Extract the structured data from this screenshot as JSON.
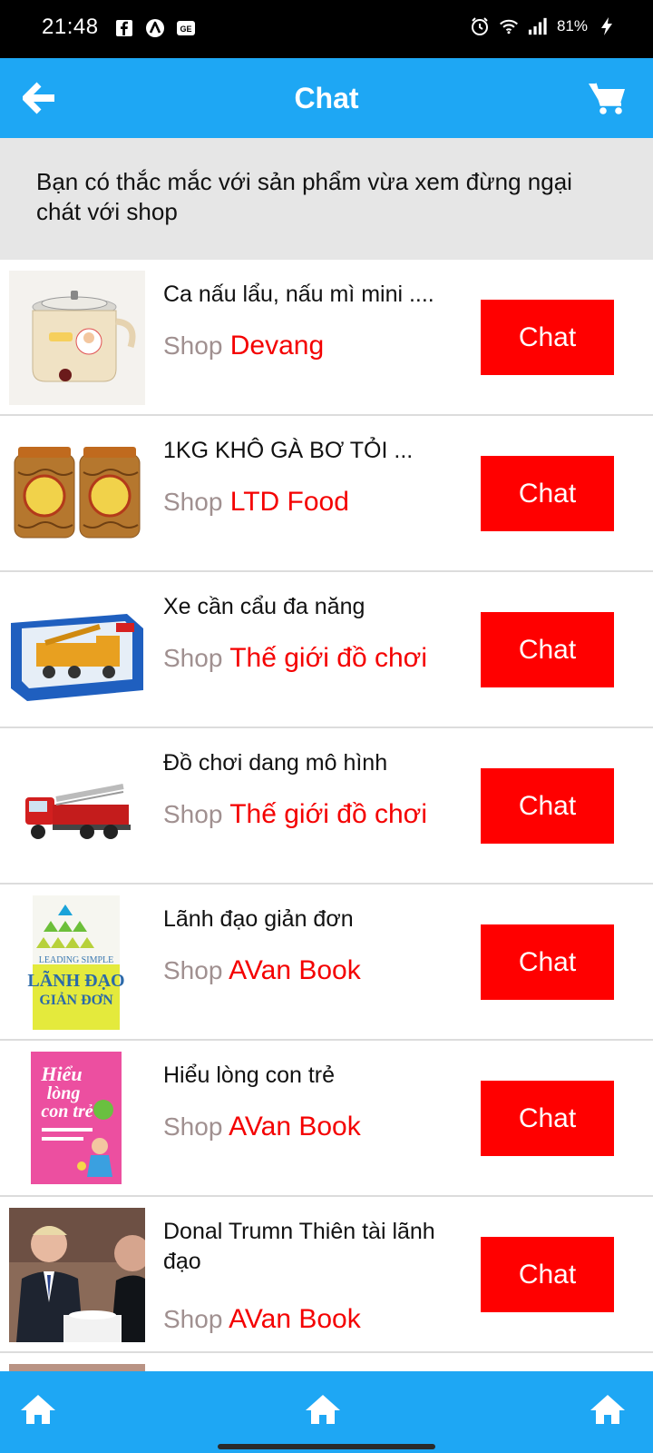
{
  "status_bar": {
    "time": "21:48",
    "battery": "81%",
    "left_icons": [
      "facebook-icon",
      "app-a-icon",
      "ge-icon"
    ],
    "right_icons": [
      "alarm-icon",
      "wifi-icon",
      "signal-icon",
      "charging-icon"
    ]
  },
  "header": {
    "title": "Chat",
    "back_icon": "arrow-left-icon",
    "cart_icon": "cart-icon"
  },
  "notice": {
    "text": "Bạn có thắc mắc với sản phẩm vừa xem đừng ngại chát với shop"
  },
  "items": [
    {
      "name": "Ca nấu lẩu, nấu mì mini ....",
      "shop_label": "Shop",
      "shop": "Devang",
      "button": "Chat",
      "thumb": "electric-pot-image"
    },
    {
      "name": "1KG KHÔ GÀ BƠ TỎI ...",
      "shop_label": "Shop",
      "shop": "LTD Food",
      "button": "Chat",
      "thumb": "dried-chicken-jars-image"
    },
    {
      "name": "Xe cần cẩu đa năng",
      "shop_label": "Shop",
      "shop": "Thế giới đồ chơi",
      "button": "Chat",
      "thumb": "toy-crane-truck-box-image"
    },
    {
      "name": "Đồ chơi dang mô hình",
      "shop_label": "Shop",
      "shop": "Thế giới đồ chơi",
      "button": "Chat",
      "thumb": "toy-fire-truck-image"
    },
    {
      "name": "Lãnh đạo giản đơn",
      "shop_label": "Shop",
      "shop": "AVan Book",
      "button": "Chat",
      "thumb": "book-leading-simple-image",
      "cover": {
        "line1": "LEADING SIMPLE",
        "line2": "LÃNH ĐẠO",
        "line3": "GIẢN ĐƠN"
      }
    },
    {
      "name": "Hiểu lòng con trẻ",
      "shop_label": "Shop",
      "shop": "AVan Book",
      "button": "Chat",
      "thumb": "book-hieu-long-con-tre-image",
      "cover": {
        "line1": "Hiểu",
        "line2": "lòng",
        "line3": "con trẻ"
      }
    },
    {
      "name": "Donal Trumn Thiên tài lãnh đạo",
      "shop_label": "Shop",
      "shop": "AVan Book",
      "button": "Chat",
      "thumb": "photo-people-dinner-image"
    }
  ],
  "bottom_nav": [
    {
      "icon": "home-icon"
    },
    {
      "icon": "home-icon"
    },
    {
      "icon": "home-icon"
    }
  ],
  "colors": {
    "primary": "#1ea7f4",
    "chat_button": "#ff0000",
    "shop_name": "#f40000",
    "shop_label": "#a09090",
    "notice_bg": "#e6e6e6"
  }
}
